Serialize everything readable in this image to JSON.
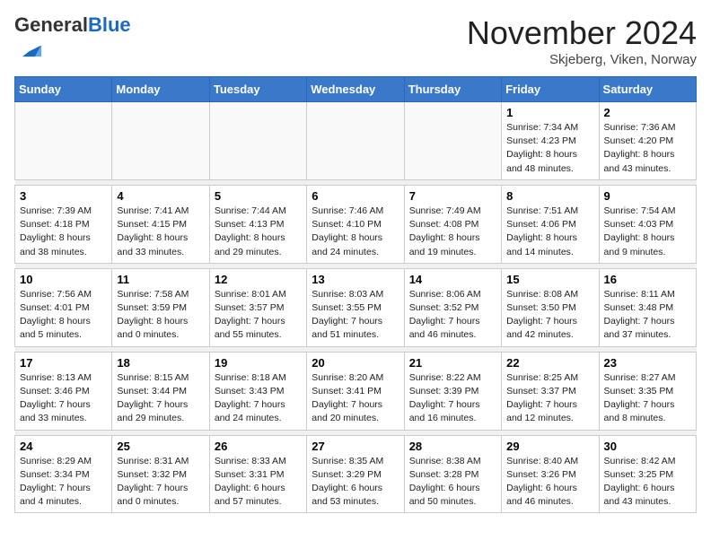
{
  "header": {
    "title": "November 2024",
    "location": "Skjeberg, Viken, Norway"
  },
  "logo": {
    "general": "General",
    "blue": "Blue"
  },
  "days_of_week": [
    "Sunday",
    "Monday",
    "Tuesday",
    "Wednesday",
    "Thursday",
    "Friday",
    "Saturday"
  ],
  "weeks": [
    [
      {
        "day": "",
        "info": ""
      },
      {
        "day": "",
        "info": ""
      },
      {
        "day": "",
        "info": ""
      },
      {
        "day": "",
        "info": ""
      },
      {
        "day": "",
        "info": ""
      },
      {
        "day": "1",
        "info": "Sunrise: 7:34 AM\nSunset: 4:23 PM\nDaylight: 8 hours and 48 minutes."
      },
      {
        "day": "2",
        "info": "Sunrise: 7:36 AM\nSunset: 4:20 PM\nDaylight: 8 hours and 43 minutes."
      }
    ],
    [
      {
        "day": "3",
        "info": "Sunrise: 7:39 AM\nSunset: 4:18 PM\nDaylight: 8 hours and 38 minutes."
      },
      {
        "day": "4",
        "info": "Sunrise: 7:41 AM\nSunset: 4:15 PM\nDaylight: 8 hours and 33 minutes."
      },
      {
        "day": "5",
        "info": "Sunrise: 7:44 AM\nSunset: 4:13 PM\nDaylight: 8 hours and 29 minutes."
      },
      {
        "day": "6",
        "info": "Sunrise: 7:46 AM\nSunset: 4:10 PM\nDaylight: 8 hours and 24 minutes."
      },
      {
        "day": "7",
        "info": "Sunrise: 7:49 AM\nSunset: 4:08 PM\nDaylight: 8 hours and 19 minutes."
      },
      {
        "day": "8",
        "info": "Sunrise: 7:51 AM\nSunset: 4:06 PM\nDaylight: 8 hours and 14 minutes."
      },
      {
        "day": "9",
        "info": "Sunrise: 7:54 AM\nSunset: 4:03 PM\nDaylight: 8 hours and 9 minutes."
      }
    ],
    [
      {
        "day": "10",
        "info": "Sunrise: 7:56 AM\nSunset: 4:01 PM\nDaylight: 8 hours and 5 minutes."
      },
      {
        "day": "11",
        "info": "Sunrise: 7:58 AM\nSunset: 3:59 PM\nDaylight: 8 hours and 0 minutes."
      },
      {
        "day": "12",
        "info": "Sunrise: 8:01 AM\nSunset: 3:57 PM\nDaylight: 7 hours and 55 minutes."
      },
      {
        "day": "13",
        "info": "Sunrise: 8:03 AM\nSunset: 3:55 PM\nDaylight: 7 hours and 51 minutes."
      },
      {
        "day": "14",
        "info": "Sunrise: 8:06 AM\nSunset: 3:52 PM\nDaylight: 7 hours and 46 minutes."
      },
      {
        "day": "15",
        "info": "Sunrise: 8:08 AM\nSunset: 3:50 PM\nDaylight: 7 hours and 42 minutes."
      },
      {
        "day": "16",
        "info": "Sunrise: 8:11 AM\nSunset: 3:48 PM\nDaylight: 7 hours and 37 minutes."
      }
    ],
    [
      {
        "day": "17",
        "info": "Sunrise: 8:13 AM\nSunset: 3:46 PM\nDaylight: 7 hours and 33 minutes."
      },
      {
        "day": "18",
        "info": "Sunrise: 8:15 AM\nSunset: 3:44 PM\nDaylight: 7 hours and 29 minutes."
      },
      {
        "day": "19",
        "info": "Sunrise: 8:18 AM\nSunset: 3:43 PM\nDaylight: 7 hours and 24 minutes."
      },
      {
        "day": "20",
        "info": "Sunrise: 8:20 AM\nSunset: 3:41 PM\nDaylight: 7 hours and 20 minutes."
      },
      {
        "day": "21",
        "info": "Sunrise: 8:22 AM\nSunset: 3:39 PM\nDaylight: 7 hours and 16 minutes."
      },
      {
        "day": "22",
        "info": "Sunrise: 8:25 AM\nSunset: 3:37 PM\nDaylight: 7 hours and 12 minutes."
      },
      {
        "day": "23",
        "info": "Sunrise: 8:27 AM\nSunset: 3:35 PM\nDaylight: 7 hours and 8 minutes."
      }
    ],
    [
      {
        "day": "24",
        "info": "Sunrise: 8:29 AM\nSunset: 3:34 PM\nDaylight: 7 hours and 4 minutes."
      },
      {
        "day": "25",
        "info": "Sunrise: 8:31 AM\nSunset: 3:32 PM\nDaylight: 7 hours and 0 minutes."
      },
      {
        "day": "26",
        "info": "Sunrise: 8:33 AM\nSunset: 3:31 PM\nDaylight: 6 hours and 57 minutes."
      },
      {
        "day": "27",
        "info": "Sunrise: 8:35 AM\nSunset: 3:29 PM\nDaylight: 6 hours and 53 minutes."
      },
      {
        "day": "28",
        "info": "Sunrise: 8:38 AM\nSunset: 3:28 PM\nDaylight: 6 hours and 50 minutes."
      },
      {
        "day": "29",
        "info": "Sunrise: 8:40 AM\nSunset: 3:26 PM\nDaylight: 6 hours and 46 minutes."
      },
      {
        "day": "30",
        "info": "Sunrise: 8:42 AM\nSunset: 3:25 PM\nDaylight: 6 hours and 43 minutes."
      }
    ]
  ]
}
